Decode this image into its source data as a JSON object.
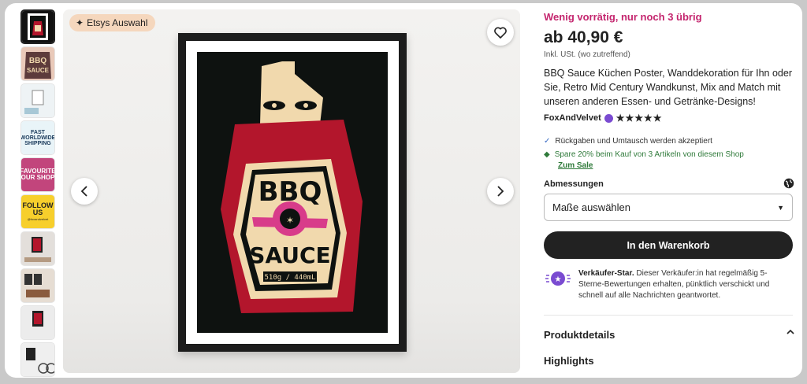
{
  "gallery": {
    "badge_label": "Etsys Auswahl",
    "thumbnails": [
      {
        "text": "",
        "bg": "#111111"
      },
      {
        "text": "BBQ SAUCE",
        "bg": "#e9c9b9"
      },
      {
        "text": "",
        "bg": "#dfe9ee"
      },
      {
        "text": "FAST WORLDWIDE SHIPPING",
        "bg": "#e9f4f8"
      },
      {
        "text": "FAVOURITE OUR SHOP",
        "bg": "#c2457c"
      },
      {
        "text": "FOLLOW US",
        "bg": "#f7cf2c"
      },
      {
        "text": "",
        "bg": "#dcd8d4"
      },
      {
        "text": "",
        "bg": "#d9cfc5"
      },
      {
        "text": "",
        "bg": "#e5e5e5"
      },
      {
        "text": "",
        "bg": "#e8e8e8"
      }
    ],
    "follow_handle": "@foxandvelvet"
  },
  "poster": {
    "line1": "BBQ",
    "line2": "SAUCE",
    "weight": "510g / 440mL"
  },
  "product": {
    "stock_notice": "Wenig vorrätig, nur noch 3 übrig",
    "price": "ab 40,90 €",
    "vat_note": "Inkl. USt. (wo zutreffend)",
    "title": "BBQ Sauce Küchen Poster, Wanddekoration für Ihn oder Sie, Retro Mid Century Wandkunst, Mix and Match mit unseren anderen Essen- und Getränke-Designs!",
    "shop_name": "FoxAndVelvet",
    "rating_stars": "★★★★★",
    "perks": {
      "returns": "Rückgaben und Umtausch werden akzeptiert",
      "discount": "Spare 20% beim Kauf von 3 Artikeln von diesem Shop",
      "sale_link": "Zum Sale"
    },
    "dimensions_label": "Abmessungen",
    "dimensions_select": "Maße auswählen",
    "cart_button": "In den Warenkorb",
    "star_seller_title": "Verkäufer-Star.",
    "star_seller_text": "Dieser Verkäufer:in hat regelmäßig 5-Sterne-Bewertungen erhalten, pünktlich verschickt und schnell auf alle Nachrichten geantwortet.",
    "details_heading": "Produktdetails",
    "highlights_heading": "Highlights"
  },
  "colors": {
    "stock": "#c4256e",
    "green": "#2f7a3a",
    "button": "#222222",
    "badge": "#f5d7bd"
  }
}
